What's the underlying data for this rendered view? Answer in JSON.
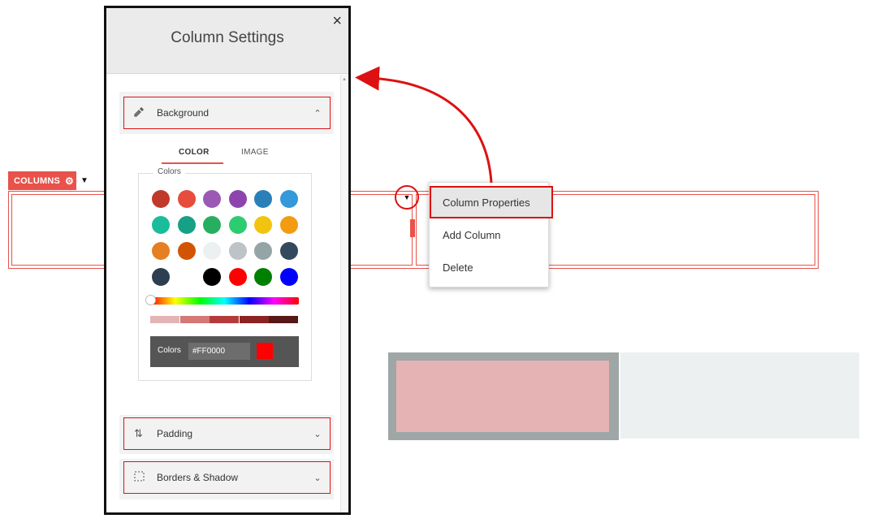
{
  "canvas": {
    "columns_badge": "COLUMNS",
    "context_menu": [
      {
        "label": "Column Properties"
      },
      {
        "label": "Add Column"
      },
      {
        "label": "Delete"
      }
    ]
  },
  "panel": {
    "title": "Column Settings",
    "close_glyph": "×",
    "sections": {
      "background": {
        "label": "Background",
        "icon": "eyedropper-icon"
      },
      "padding": {
        "label": "Padding",
        "icon": "padding-arrows-icon"
      },
      "borders": {
        "label": "Borders & Shadow",
        "icon": "border-dashed-icon"
      }
    },
    "tabs": [
      {
        "label": "COLOR",
        "active": true
      },
      {
        "label": "IMAGE",
        "active": false
      }
    ],
    "colors_legend": "Colors",
    "swatches": [
      "#c0392b",
      "#e74c3c",
      "#9b59b6",
      "#8e44ad",
      "#2980b9",
      "#3498db",
      "#1abc9c",
      "#16a085",
      "#27ae60",
      "#2ecc71",
      "#f1c40f",
      "#f39c12",
      "#e67e22",
      "#d35400",
      "#ecf0f1",
      "#bdc3c7",
      "#95a5a6",
      "#34495e",
      "#2c3e50",
      "#ffffff",
      "#000000",
      "#ff0000",
      "#008000",
      "#0000ff"
    ],
    "shades": [
      "#e3b4b4",
      "#d47878",
      "#b53b3b",
      "#8c2323",
      "#561717"
    ],
    "hex_label": "Colors",
    "hex_value": "#FF0000",
    "selected_color": "#ff0000"
  },
  "colors": {
    "accent": "#e8524a",
    "highlight": "#dd1111"
  }
}
